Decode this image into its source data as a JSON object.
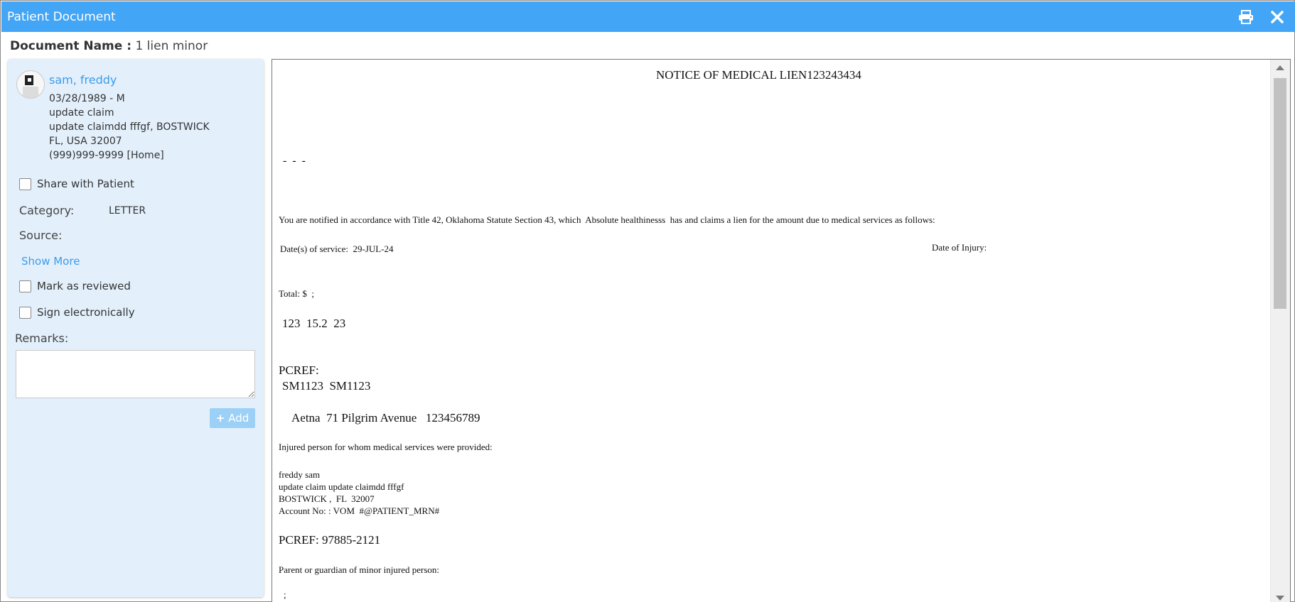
{
  "window": {
    "title": "Patient Document",
    "print_icon": "print-icon",
    "close_icon": "close-icon"
  },
  "document_name": {
    "label": "Document Name :",
    "value": "1 lien minor"
  },
  "patient": {
    "name": "sam, freddy",
    "dob_gender": "03/28/1989 - M",
    "address_line1": "update claim",
    "address_line2": "update claimdd fffgf, BOSTWICK",
    "address_line3": "FL, USA 32007",
    "phone": "(999)999-9999 [Home]"
  },
  "sidebar": {
    "share_label": "Share with Patient",
    "category_label": "Category:",
    "category_value": "LETTER",
    "source_label": "Source:",
    "show_more": "Show More",
    "mark_reviewed": "Mark as reviewed",
    "sign_electronically": "Sign electronically",
    "remarks_label": "Remarks:",
    "add_button": "Add",
    "add_icon": "plus-icon"
  },
  "document": {
    "heading": "NOTICE OF MEDICAL LIEN123243434",
    "dashes": "-  -  -",
    "notice_text": "You are notified in accordance with Title 42, Oklahoma Statute Section 43, which  Absolute healthinesss  has and claims a lien for the amount due to medical services as follows:",
    "dates_of_service": "Date(s) of service:  29-JUL-24",
    "date_of_injury": "Date of Injury:",
    "total": "Total: $  ;",
    "amounts": "123  15.2  23",
    "pcref_label": "PCREF:",
    "pcref_values": "SM1123  SM1123",
    "insurer_line": "Aetna  71 Pilgrim Avenue   123456789",
    "injured_person_label": "Injured person for whom medical services were provided:",
    "injured_name": "freddy sam",
    "injured_address1": "update claim update claimdd fffgf",
    "injured_address2": "BOSTWICK ,  FL  32007",
    "account_no": "Account No: : VOM  #@PATIENT_MRN#",
    "pcref_number": "PCREF: 97885-2121",
    "guardian_label": "Parent or guardian of minor injured person:",
    "guardian_value": ";"
  }
}
